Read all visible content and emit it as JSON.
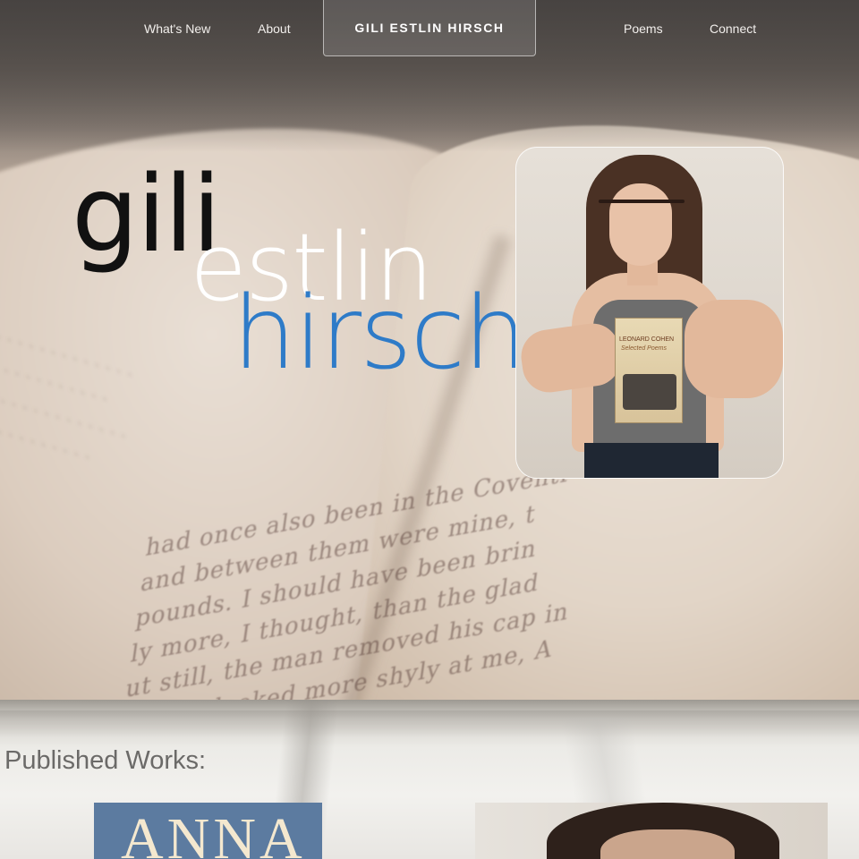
{
  "nav": {
    "items": [
      {
        "label": "What's New"
      },
      {
        "label": "About"
      },
      {
        "label": "Poems"
      },
      {
        "label": "Connect"
      }
    ],
    "brand": "GILI ESTLIN HIRSCH"
  },
  "logo": {
    "line1": "gili",
    "line2": "estlin",
    "line3": "hirsch",
    "colors": {
      "line1": "#111111",
      "line2": "#ffffff",
      "line3": "#2e7bc8"
    }
  },
  "hero_text": {
    "lines": [
      "had once also been in the Coventr",
      "and between them were mine, t",
      "pounds. I should have been brin",
      "ly more, I thought, than the glad",
      "ut still, the man removed his cap in",
      "ugh he looked more shyly at me, A"
    ]
  },
  "portrait": {
    "book_title": "LEONARD COHEN",
    "book_subtitle": "Selected Poems"
  },
  "works": {
    "title": "Published Works:",
    "book1_title": "ANNA"
  }
}
